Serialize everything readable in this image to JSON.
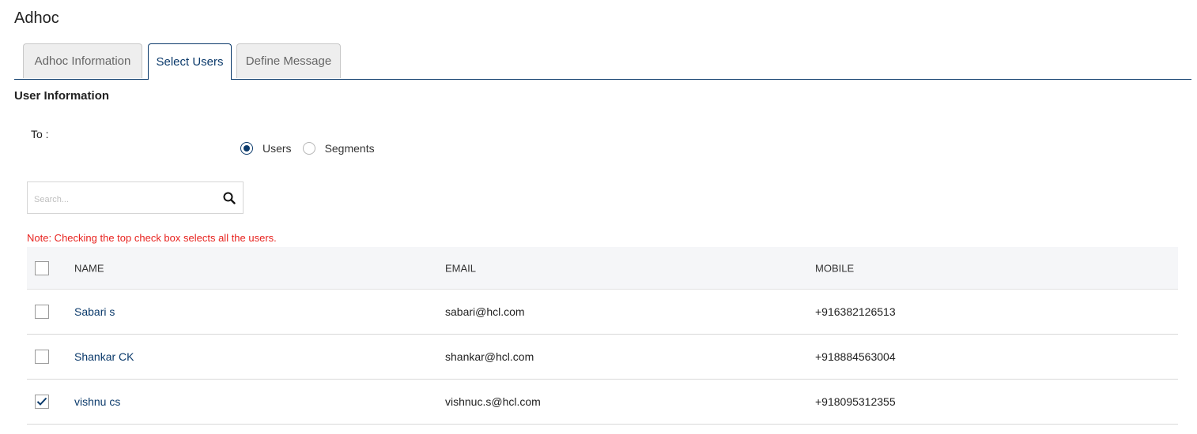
{
  "page": {
    "title": "Adhoc"
  },
  "tabs": [
    {
      "label": "Adhoc Information",
      "active": false
    },
    {
      "label": "Select Users",
      "active": true
    },
    {
      "label": "Define Message",
      "active": false
    }
  ],
  "section": {
    "title": "User Information"
  },
  "recipient": {
    "label": "To :",
    "options": [
      {
        "label": "Users",
        "selected": true
      },
      {
        "label": "Segments",
        "selected": false
      }
    ]
  },
  "search": {
    "placeholder": "Search...",
    "value": "",
    "icon": "search-icon"
  },
  "note": "Note: Checking the top check box selects all the users.",
  "table": {
    "select_all_checked": false,
    "columns": [
      "NAME",
      "EMAIL",
      "MOBILE"
    ],
    "rows": [
      {
        "checked": false,
        "name": "Sabari s",
        "email": "sabari@hcl.com",
        "mobile": "+916382126513"
      },
      {
        "checked": false,
        "name": "Shankar CK",
        "email": "shankar@hcl.com",
        "mobile": "+918884563004"
      },
      {
        "checked": true,
        "name": "vishnu cs",
        "email": "vishnuc.s@hcl.com",
        "mobile": "+918095312355"
      }
    ]
  },
  "colors": {
    "accent": "#0b3a6b",
    "note": "#e8231f",
    "header_bg": "#f5f6f8"
  }
}
